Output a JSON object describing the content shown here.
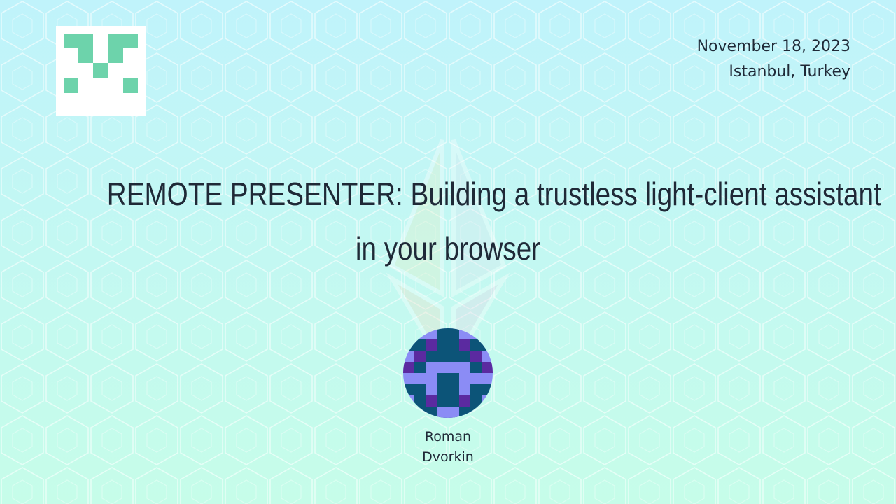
{
  "slide": {
    "date": "November 18, 2023",
    "location": "Istanbul, Turkey",
    "title_line_1": "REMOTE PRESENTER: Building a trustless light-client assistant",
    "title_line_2": "in your browser",
    "speaker_first_name": "Roman",
    "speaker_last_name": "Dvorkin"
  },
  "colors": {
    "background_top": "#c0f3fb",
    "background_bottom": "#c6fde9",
    "text": "#1f2937",
    "logo_green": "#6dd3ab",
    "avatar_dark": "#0c5478",
    "avatar_light": "#8b8cf5",
    "avatar_purple": "#5b2aa0"
  },
  "icons": {
    "logo": "pixel-v-logo",
    "watermark": "ethereum-diamond-icon",
    "avatar": "pixel-identicon-avatar"
  }
}
